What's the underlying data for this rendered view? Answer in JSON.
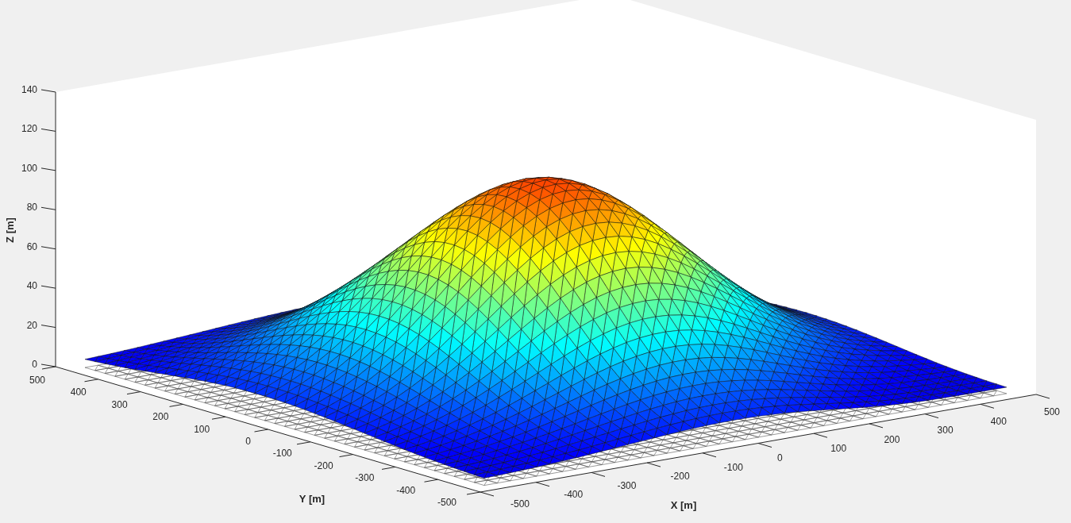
{
  "figure": {
    "axes": {
      "zlabel": "Z [m]",
      "ylabel": "Y [m]",
      "xlabel": "X [m]",
      "zticks": [
        "140",
        "120",
        "100",
        "80",
        "60",
        "40",
        "20",
        "0"
      ],
      "yticks": [
        "500",
        "400",
        "300",
        "200",
        "100",
        "0",
        "-100",
        "-200",
        "-300",
        "-400",
        "-500"
      ],
      "xticks": [
        "-500",
        "-400",
        "-300",
        "-200",
        "-100",
        "0",
        "100",
        "200",
        "300",
        "400",
        "500"
      ]
    }
  }
}
